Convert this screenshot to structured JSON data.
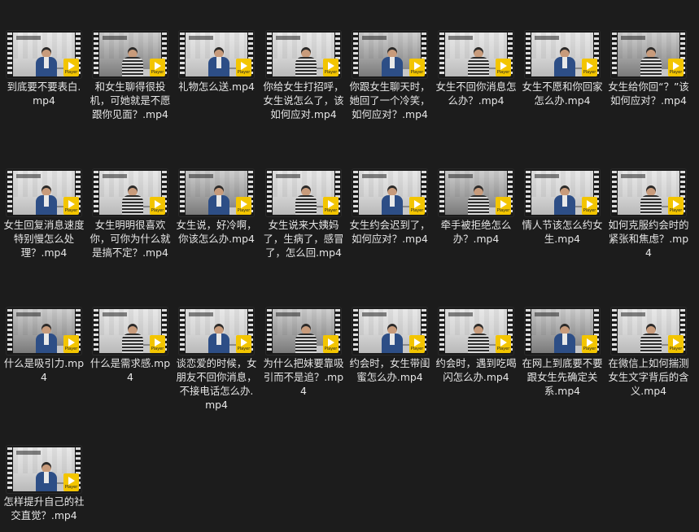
{
  "files": [
    {
      "name": "到底要不要表白.mp4",
      "badge": "Player"
    },
    {
      "name": "和女生聊得很投机，可她就是不愿跟你见面？.mp4",
      "badge": "Player"
    },
    {
      "name": "礼物怎么送.mp4",
      "badge": "Player"
    },
    {
      "name": "你给女生打招呼，女生说怎么了，该如何应对.mp4",
      "badge": "Player"
    },
    {
      "name": "你跟女生聊天时，她回了一个冷笑，如何应对？.mp4",
      "badge": "Player"
    },
    {
      "name": "女生不回你消息怎么办？.mp4",
      "badge": "Player"
    },
    {
      "name": "女生不愿和你回家怎么办.mp4",
      "badge": "Player"
    },
    {
      "name": "女生给你回“？”该如何应对？.mp4",
      "badge": "Player"
    },
    {
      "name": "女生回复消息速度特别慢怎么处理？.mp4",
      "badge": "Player"
    },
    {
      "name": "女生明明很喜欢你，可你为什么就是搞不定？.mp4",
      "badge": "Player"
    },
    {
      "name": "女生说，好冷啊，你该怎么办.mp4",
      "badge": "Player"
    },
    {
      "name": "女生说来大姨妈了，生病了，感冒了，怎么回.mp4",
      "badge": "Player"
    },
    {
      "name": "女生约会迟到了，如何应对？.mp4",
      "badge": "Player"
    },
    {
      "name": "牵手被拒绝怎么办？.mp4",
      "badge": "Player"
    },
    {
      "name": "情人节该怎么约女生.mp4",
      "badge": "Player"
    },
    {
      "name": "如何克服约会时的紧张和焦虑？.mp4",
      "badge": "Player"
    },
    {
      "name": "什么是吸引力.mp4",
      "badge": "Player"
    },
    {
      "name": "什么是需求感.mp4",
      "badge": "Player"
    },
    {
      "name": "谈恋爱的时候，女朋友不回你消息，不接电话怎么办.mp4",
      "badge": "Player"
    },
    {
      "name": "为什么把妹要靠吸引而不是追？.mp4",
      "badge": "Player"
    },
    {
      "name": "约会时，女生带闺蜜怎么办.mp4",
      "badge": "Player"
    },
    {
      "name": "约会时，遇到吃喝闪怎么办.mp4",
      "badge": "Player"
    },
    {
      "name": "在网上到底要不要跟女生先确定关系.mp4",
      "badge": "Player"
    },
    {
      "name": "在微信上如何揣测女生文字背后的含义.mp4",
      "badge": "Player"
    },
    {
      "name": "怎样提升自己的社交直觉？.mp4",
      "badge": "Player"
    }
  ]
}
